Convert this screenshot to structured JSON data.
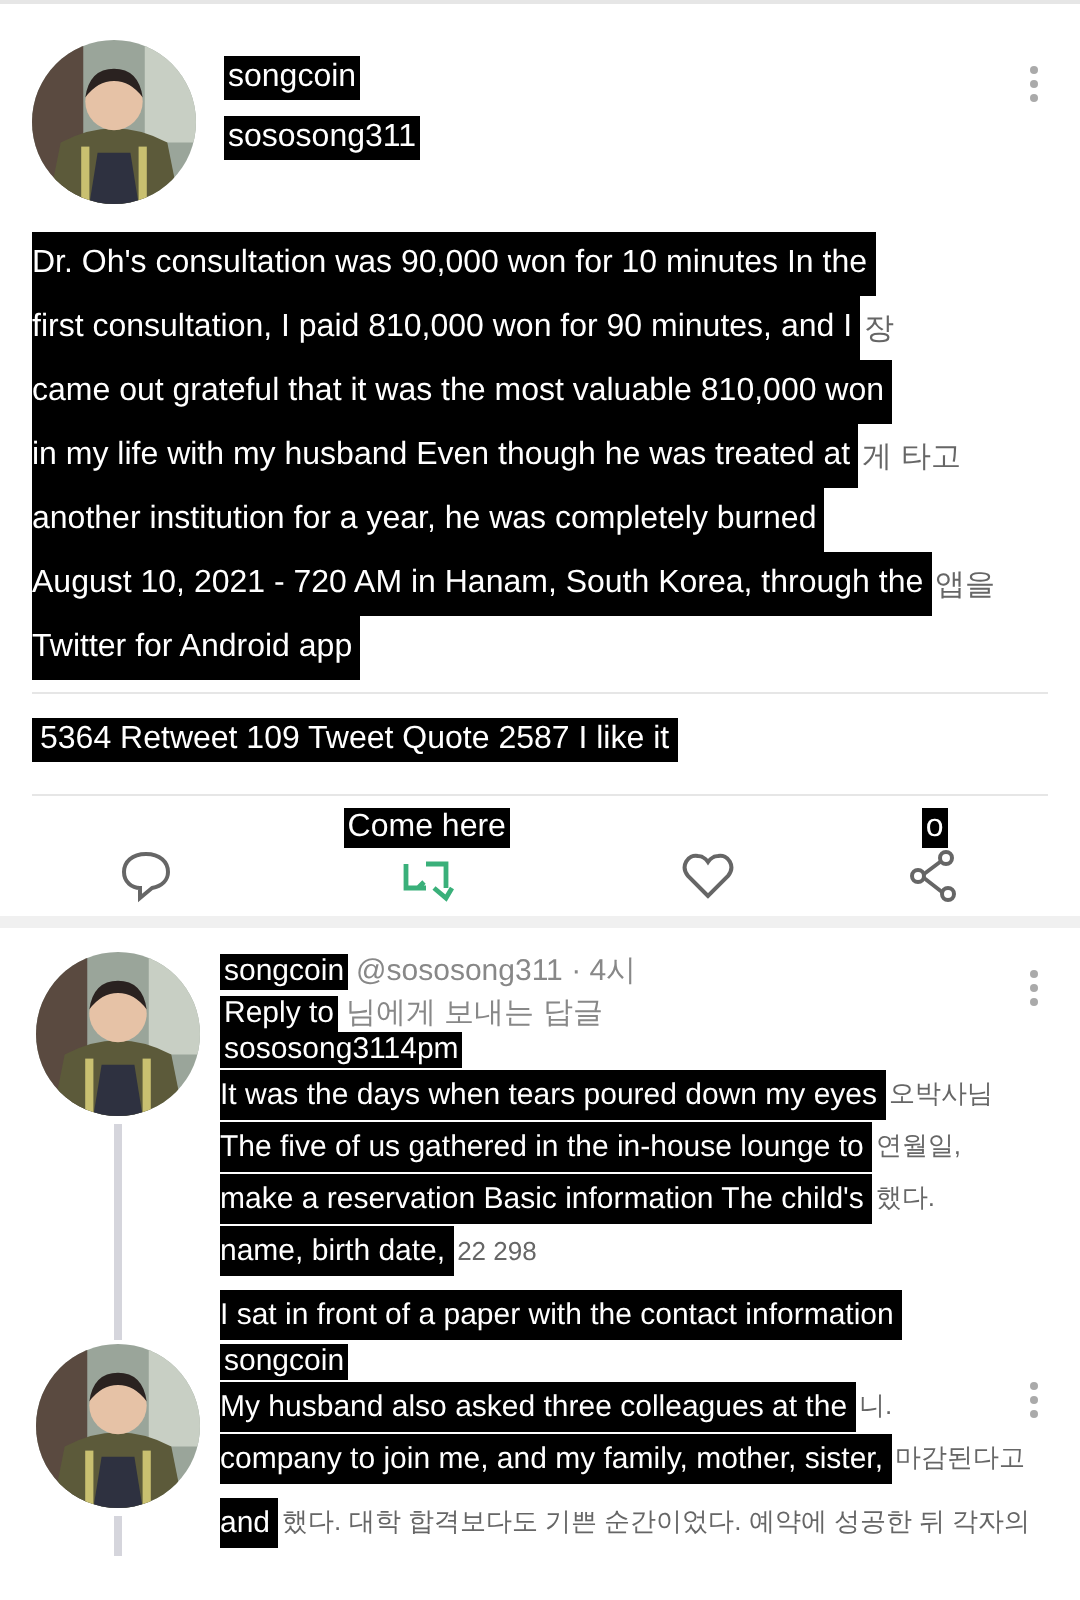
{
  "tweet": {
    "author": {
      "name": "songcoin",
      "handle": "sososong311"
    },
    "body_lines": [
      {
        "text": "Dr. Oh's consultation was 90,000 won for 10 minutes In the"
      },
      {
        "text": "first consultation, I paid 810,000 won for 90 minutes, and I",
        "trail": "장"
      },
      {
        "text": "came out grateful that it was the most valuable 810,000 won"
      },
      {
        "text": "in my life with my husband Even though he was treated at",
        "trail": "게 타고"
      },
      {
        "text": "another institution for a year, he was completely burned"
      },
      {
        "text": "August 10, 2021 - 720 AM in Hanam, South Korea, through the",
        "trail": "앱을"
      },
      {
        "text": "Twitter for Android app"
      }
    ],
    "stats": "5364 Retweet 109 Tweet Quote 2587 I like it",
    "actions": [
      {
        "kind": "reply"
      },
      {
        "kind": "retweet",
        "label": "Come here"
      },
      {
        "kind": "like"
      },
      {
        "kind": "share",
        "label": "o"
      }
    ]
  },
  "replies": [
    {
      "author": {
        "name": "songcoin",
        "handle": "@sososong311 · 4시"
      },
      "reply_to": "Reply to",
      "reply_to_trail": "님에게 보내는 답글",
      "meta": "sososong3114pm",
      "lines": [
        {
          "text": "It was the days when tears poured down my eyes",
          "trail": "오박사님"
        },
        {
          "text": "The five of us gathered in the in-house lounge to",
          "trail": "연월일,"
        },
        {
          "text": "make a reservation Basic information The child's",
          "trail": "했다."
        },
        {
          "text": "name, birth date,",
          "trail": "22 298"
        },
        {
          "text": "I sat in front of a paper with the contact information"
        }
      ]
    },
    {
      "author": {
        "name": "songcoin"
      },
      "lines": [
        {
          "text": "My husband also asked three colleagues at the",
          "trail": "니."
        },
        {
          "text": "company to join me, and my family, mother, sister,",
          "trail": "마감된다고"
        },
        {
          "text": "and",
          "trail": "했다. 대학 합격보다도 기쁜 순간이었다. 예약에 성공한 뒤 각자의"
        }
      ]
    }
  ]
}
